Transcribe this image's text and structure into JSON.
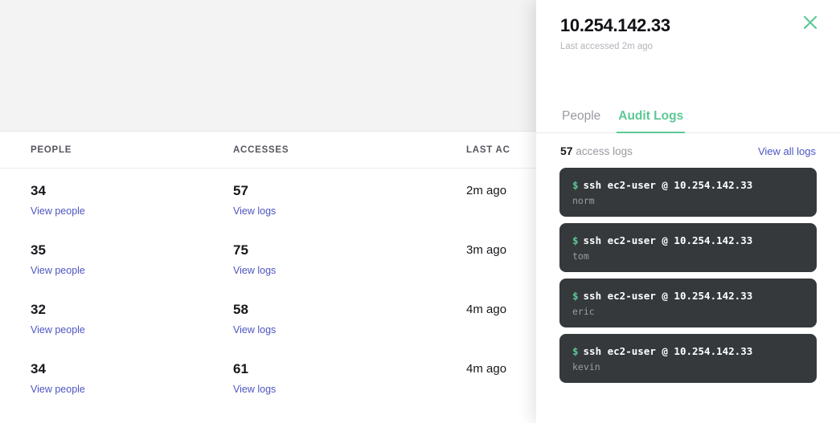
{
  "table": {
    "columns": [
      "PEOPLE",
      "ACCESSES",
      "LAST AC"
    ],
    "people_link_label": "View people",
    "logs_link_label": "View logs",
    "rows": [
      {
        "people": "34",
        "accesses": "57",
        "last_access": "2m ago"
      },
      {
        "people": "35",
        "accesses": "75",
        "last_access": "3m ago"
      },
      {
        "people": "32",
        "accesses": "58",
        "last_access": "4m ago"
      },
      {
        "people": "34",
        "accesses": "61",
        "last_access": "4m ago"
      }
    ]
  },
  "panel": {
    "title": "10.254.142.33",
    "subtitle": "Last accessed 2m ago",
    "close_icon": "close-icon",
    "tabs": [
      {
        "label": "People",
        "active": false
      },
      {
        "label": "Audit Logs",
        "active": true
      }
    ],
    "logs_count": "57",
    "logs_count_suffix": "access logs",
    "view_all_label": "View all logs",
    "logs": [
      {
        "prompt": "$",
        "command": "ssh ec2-user @ 10.254.142.33",
        "user": "norm"
      },
      {
        "prompt": "$",
        "command": "ssh ec2-user @ 10.254.142.33",
        "user": "tom"
      },
      {
        "prompt": "$",
        "command": "ssh ec2-user @ 10.254.142.33",
        "user": "eric"
      },
      {
        "prompt": "$",
        "command": "ssh ec2-user @ 10.254.142.33",
        "user": "kevin"
      }
    ]
  },
  "colors": {
    "accent_green": "#5cc894",
    "link_blue": "#4d55c2",
    "terminal_bg": "#35393c",
    "hero_bg": "#f3f3f4"
  }
}
